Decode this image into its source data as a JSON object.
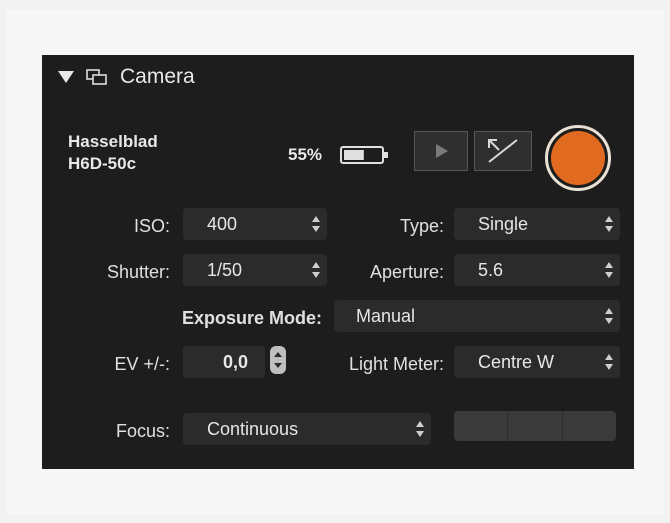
{
  "panel": {
    "title": "Camera",
    "colors": {
      "record": "#e06a1f",
      "panel_bg": "#1d1d1d"
    }
  },
  "camera": {
    "model_line1": "Hasselblad",
    "model_line2": "H6D-50c",
    "battery_percent": "55%",
    "battery_level": 0.55
  },
  "icons": {
    "collapse": "disclosure-triangle-down-icon",
    "window": "window-icon",
    "battery": "battery-icon",
    "play": "play-icon",
    "expand": "expand-arrows-icon",
    "record": "record-icon",
    "stepper": "up-down-stepper-icon"
  },
  "settings": {
    "iso_label": "ISO:",
    "iso_value": "400",
    "type_label": "Type:",
    "type_value": "Single",
    "shutter_label": "Shutter:",
    "shutter_value": "1/50",
    "aperture_label": "Aperture:",
    "aperture_value": "5.6",
    "exposure_mode_label": "Exposure Mode:",
    "exposure_mode_value": "Manual",
    "ev_label": "EV +/-:",
    "ev_value": "0,0",
    "light_meter_label": "Light Meter:",
    "light_meter_value": "Centre W",
    "focus_label": "Focus:",
    "focus_value": "Continuous"
  }
}
